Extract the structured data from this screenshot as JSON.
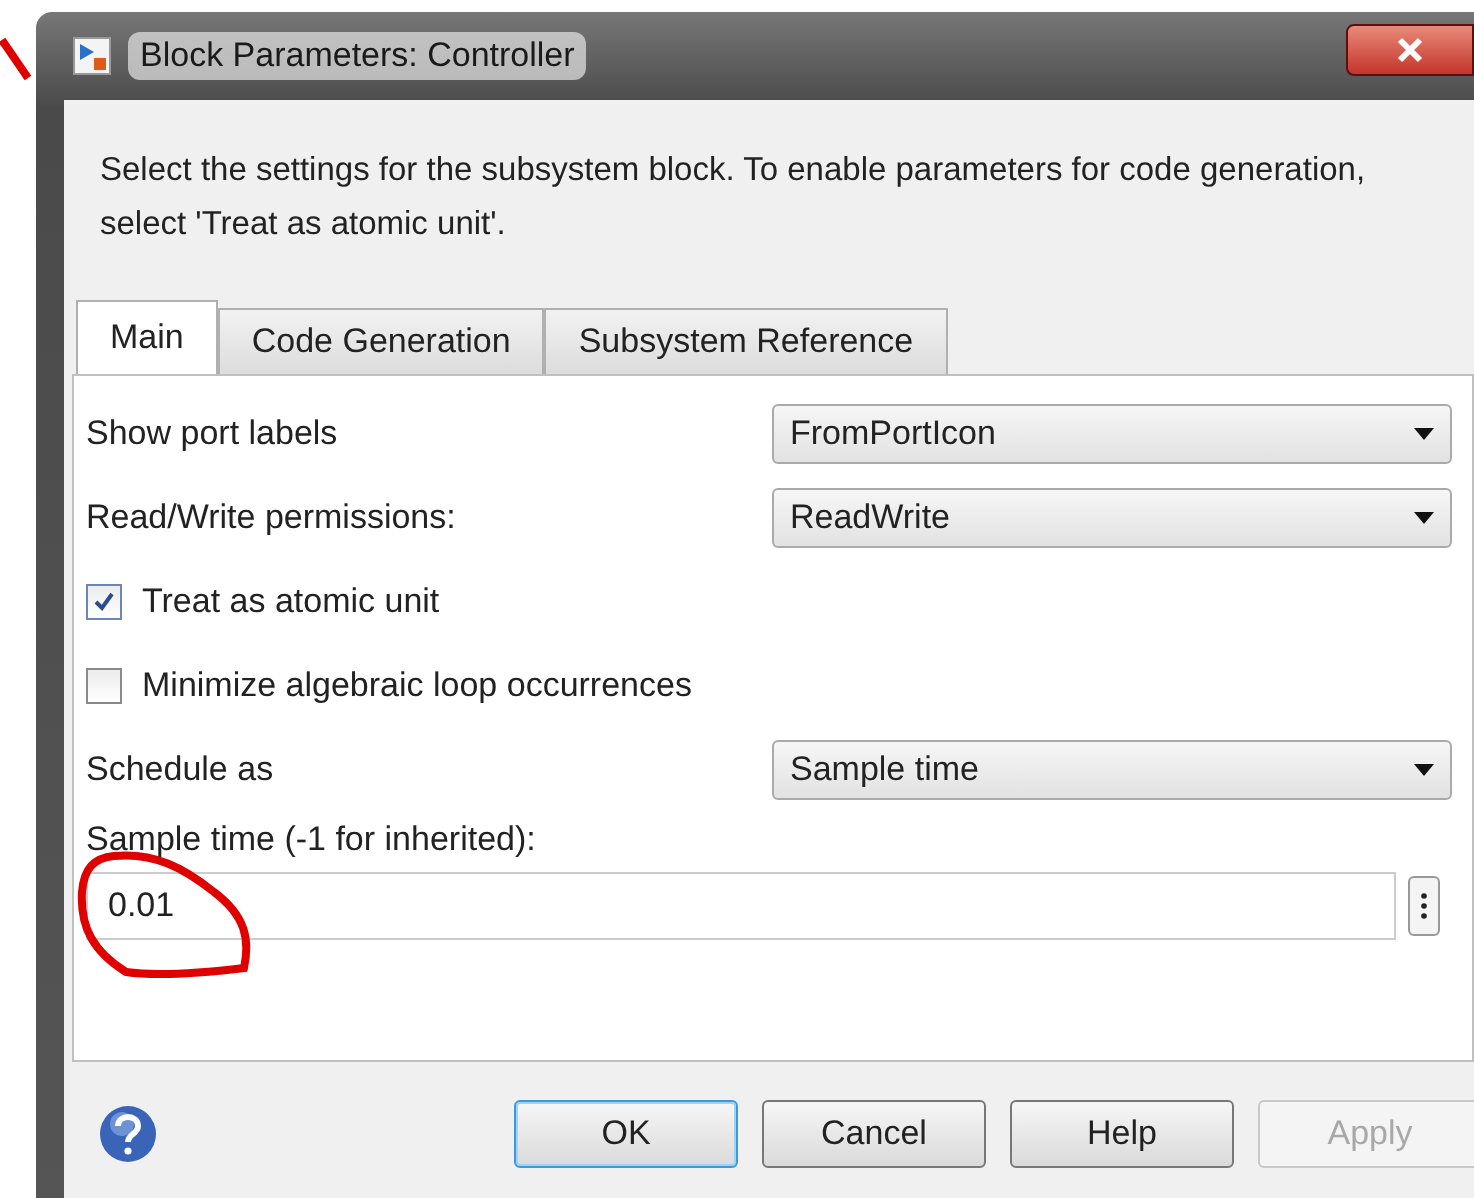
{
  "window": {
    "title": "Block Parameters: Controller"
  },
  "description": "Select the settings for the subsystem block. To enable parameters for code generation, select 'Treat as atomic unit'.",
  "tabs": [
    {
      "label": "Main",
      "selected": true
    },
    {
      "label": "Code Generation",
      "selected": false
    },
    {
      "label": "Subsystem Reference",
      "selected": false
    }
  ],
  "parameters": [
    {
      "kind": "dropdown",
      "label": "Show port labels",
      "value": "FromPortIcon"
    },
    {
      "kind": "dropdown",
      "label": "Read/Write permissions:",
      "value": "ReadWrite"
    },
    {
      "kind": "checkbox",
      "label": "Treat as atomic unit",
      "checked": true
    },
    {
      "kind": "checkbox",
      "label": "Minimize algebraic loop occurrences",
      "checked": false
    },
    {
      "kind": "dropdown",
      "label": "Schedule as",
      "value": "Sample time"
    },
    {
      "kind": "text",
      "label": "Sample time (-1 for inherited):",
      "value": "0.01"
    }
  ],
  "buttons": [
    {
      "label": "OK",
      "disabled": false,
      "default": true
    },
    {
      "label": "Cancel",
      "disabled": false,
      "default": false
    },
    {
      "label": "Help",
      "disabled": false,
      "default": false
    },
    {
      "label": "Apply",
      "disabled": true,
      "default": false
    }
  ]
}
